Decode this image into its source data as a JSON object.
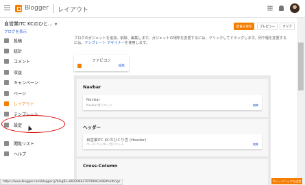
{
  "header": {
    "brand": "Blogger",
    "page_title": "レイアウト"
  },
  "blog": {
    "title": "自営業ITC  KCのひと...",
    "view_link": "ブログを表示"
  },
  "actions": {
    "save": "配置を保存",
    "preview": "プレビュー",
    "clear": "クリア"
  },
  "sidebar": {
    "items": [
      {
        "label": "投稿",
        "icon": "posts-icon"
      },
      {
        "label": "統計",
        "icon": "stats-icon"
      },
      {
        "label": "コメント",
        "icon": "comments-icon"
      },
      {
        "label": "収益",
        "icon": "earnings-icon"
      },
      {
        "label": "キャンペーン",
        "icon": "campaigns-icon"
      },
      {
        "label": "ページ",
        "icon": "pages-icon"
      },
      {
        "label": "レイアウト",
        "icon": "layout-icon"
      },
      {
        "label": "テンプレート",
        "icon": "template-icon"
      },
      {
        "label": "設定",
        "icon": "settings-icon"
      },
      {
        "label": "閲覧リスト",
        "icon": "reading-list-icon"
      },
      {
        "label": "ヘルプ",
        "icon": "help-icon"
      }
    ],
    "active_index": 6
  },
  "main": {
    "intro_text": "ブログのガジェットを追加、削除、編集します。ガジェットの場所を変更するには、クリックしてドラッグします。列や幅を変更するには、",
    "intro_link": "テンプレート デザイナー",
    "intro_tail": "を使用します。",
    "favicon": {
      "title": "ファビコン",
      "edit": "編集"
    },
    "sections": [
      {
        "title": "Navbar",
        "gadget": {
          "title": "Navbar",
          "sub": "Navbarガジェット",
          "edit": "編集"
        }
      },
      {
        "title": "ヘッダー",
        "gadget": {
          "title": "自営業ITC  KCのひとり言 (Header)",
          "sub": "ページ ヘッダーガジェット",
          "edit": "編集"
        }
      },
      {
        "title": "Cross-Column"
      }
    ]
  },
  "status_url": "https://www.blogger.com/blogger.g?blogID=8020069379749963498#settings",
  "feedback": "フィードバックを送信",
  "colors": {
    "accent": "#f57d00",
    "link": "#3367d6",
    "highlight_circle": "#e00000"
  }
}
